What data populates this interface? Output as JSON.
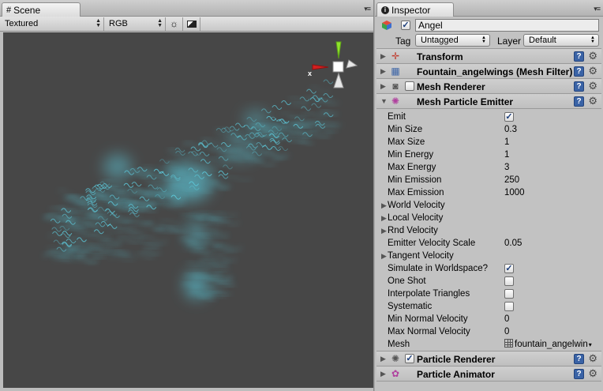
{
  "scene": {
    "tab_label": "Scene",
    "render_mode": "Textured",
    "display_mode": "RGB",
    "gizmo_axis_label": "x"
  },
  "inspector": {
    "tab_label": "Inspector",
    "object": {
      "name": "Angel",
      "active": true,
      "tag_label": "Tag",
      "tag_value": "Untagged",
      "layer_label": "Layer",
      "layer_value": "Default"
    },
    "components_top": [
      {
        "title": "Transform",
        "icon": "transform-icon",
        "has_checkbox": false
      },
      {
        "title": "Fountain_angelwings (Mesh Filter)",
        "icon": "mesh-filter-icon",
        "has_checkbox": false
      },
      {
        "title": "Mesh Renderer",
        "icon": "mesh-renderer-icon",
        "has_checkbox": true,
        "enabled": false
      }
    ],
    "emitter": {
      "title": "Mesh Particle Emitter",
      "icon": "particle-emitter-icon",
      "properties": [
        {
          "label": "Emit",
          "type": "checkbox",
          "checked": true
        },
        {
          "label": "Min Size",
          "type": "value",
          "value": "0.3"
        },
        {
          "label": "Max Size",
          "type": "value",
          "value": "1"
        },
        {
          "label": "Min Energy",
          "type": "value",
          "value": "1"
        },
        {
          "label": "Max Energy",
          "type": "value",
          "value": "3"
        },
        {
          "label": "Min Emission",
          "type": "value",
          "value": "250"
        },
        {
          "label": "Max Emission",
          "type": "value",
          "value": "1000"
        },
        {
          "label": "World Velocity",
          "type": "foldout"
        },
        {
          "label": "Local Velocity",
          "type": "foldout"
        },
        {
          "label": "Rnd Velocity",
          "type": "foldout"
        },
        {
          "label": "Emitter Velocity Scale",
          "type": "value",
          "value": "0.05"
        },
        {
          "label": "Tangent Velocity",
          "type": "foldout"
        },
        {
          "label": "Simulate in Worldspace?",
          "type": "checkbox",
          "checked": true
        },
        {
          "label": "One Shot",
          "type": "checkbox",
          "checked": false
        },
        {
          "label": "Interpolate Triangles",
          "type": "checkbox",
          "checked": false
        },
        {
          "label": "Systematic",
          "type": "checkbox",
          "checked": false
        },
        {
          "label": "Min Normal Velocity",
          "type": "value",
          "value": "0"
        },
        {
          "label": "Max Normal Velocity",
          "type": "value",
          "value": "0"
        },
        {
          "label": "Mesh",
          "type": "object",
          "value": "fountain_angelwin"
        }
      ]
    },
    "components_bottom": [
      {
        "title": "Particle Renderer",
        "icon": "particle-renderer-icon",
        "has_checkbox": true,
        "enabled": true
      },
      {
        "title": "Particle Animator",
        "icon": "particle-animator-icon",
        "has_checkbox": false
      }
    ]
  },
  "colors": {
    "viewport_bg": "#474747",
    "particle_color": "#5fd3e6",
    "gizmo_y": "#8ee32b",
    "gizmo_x": "#d32020",
    "help_icon": "#3a63a6"
  }
}
